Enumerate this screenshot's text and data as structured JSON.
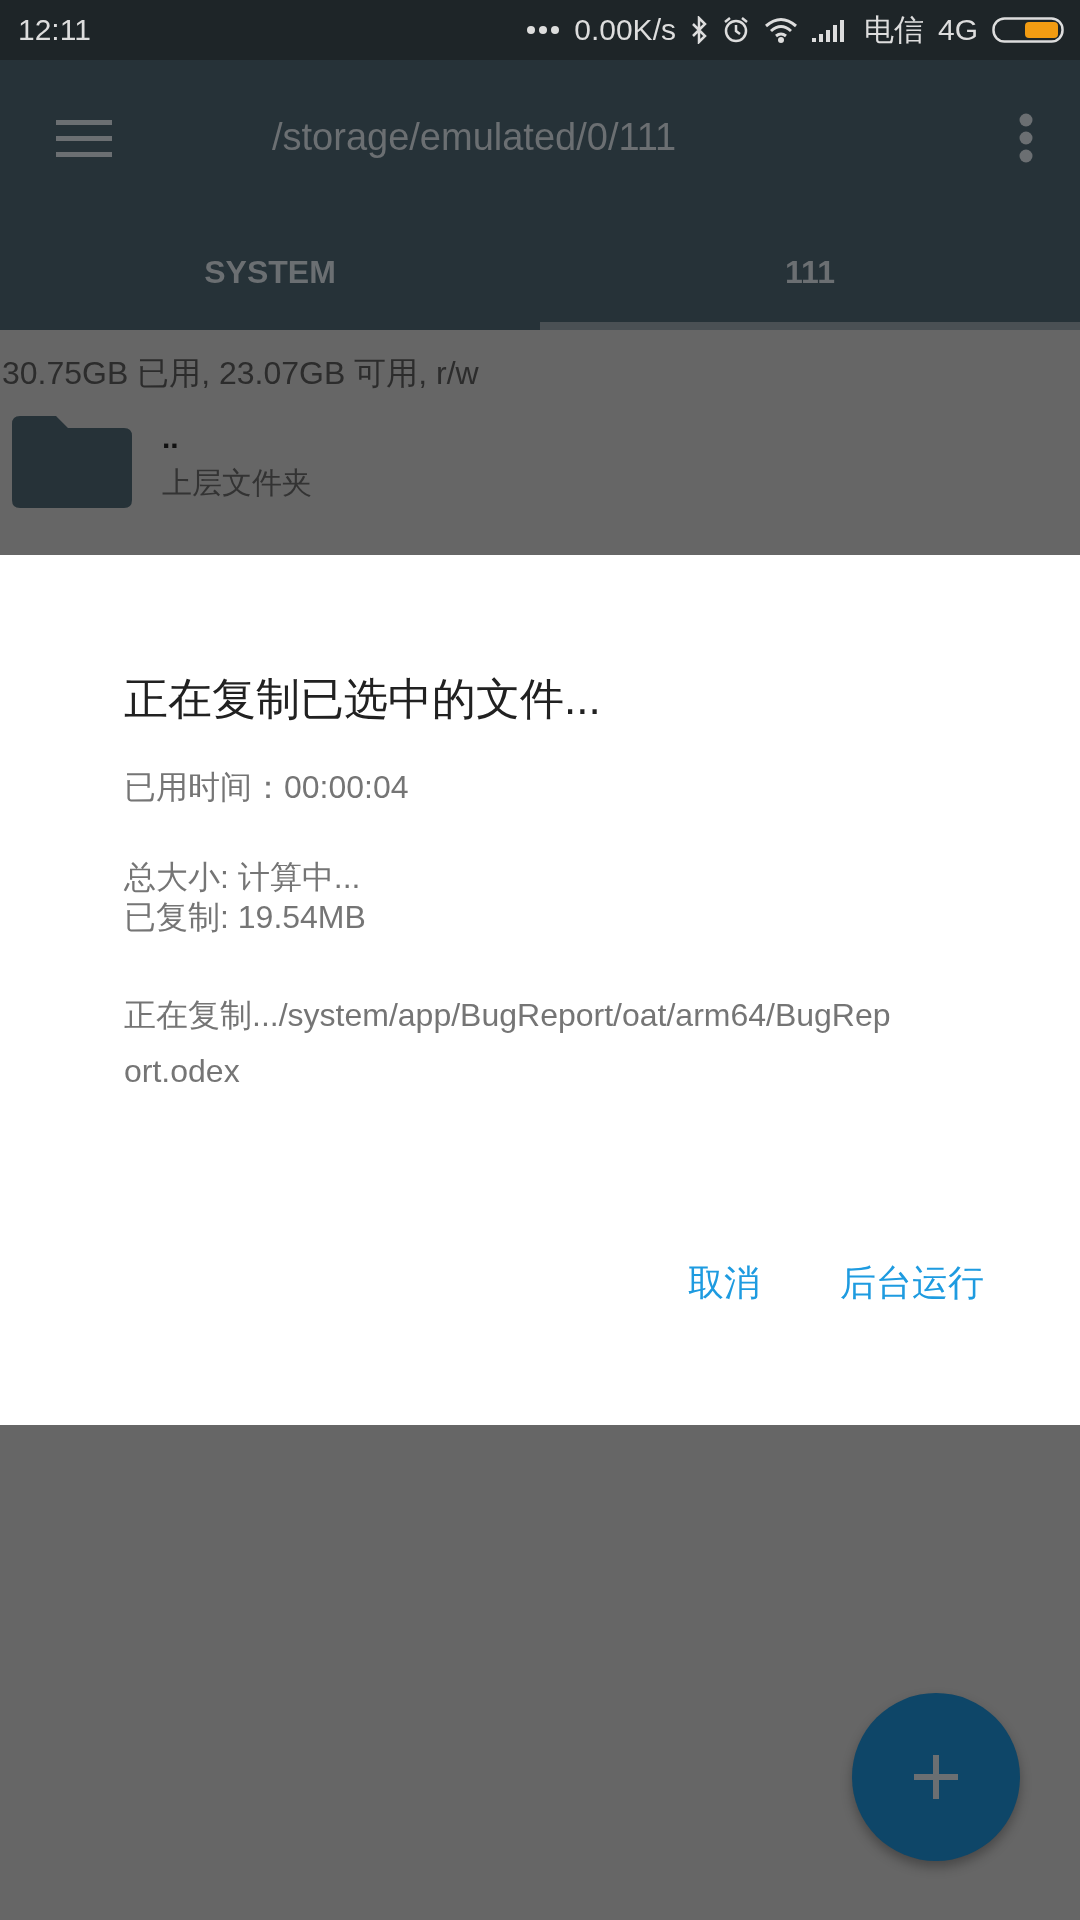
{
  "status_bar": {
    "time": "12:11",
    "speed": "0.00K/s",
    "carrier": "电信",
    "network": "4G"
  },
  "toolbar": {
    "path": "/storage/emulated/0/111"
  },
  "tabs": [
    {
      "label": "SYSTEM",
      "selected": false
    },
    {
      "label": "111",
      "selected": true
    }
  ],
  "storage_info": "30.75GB 已用, 23.07GB 可用, r/w",
  "files": [
    {
      "name": "..",
      "subtitle": "上层文件夹"
    }
  ],
  "dialog": {
    "title": "正在复制已选中的文件...",
    "elapsed": "已用时间：00:00:04",
    "total": "总大小: 计算中...",
    "copied": "已复制: 19.54MB",
    "current": "正在复制.../system/app/BugReport/oat/arm64/BugReport.odex",
    "buttons": [
      "取消",
      "后台运行"
    ]
  }
}
